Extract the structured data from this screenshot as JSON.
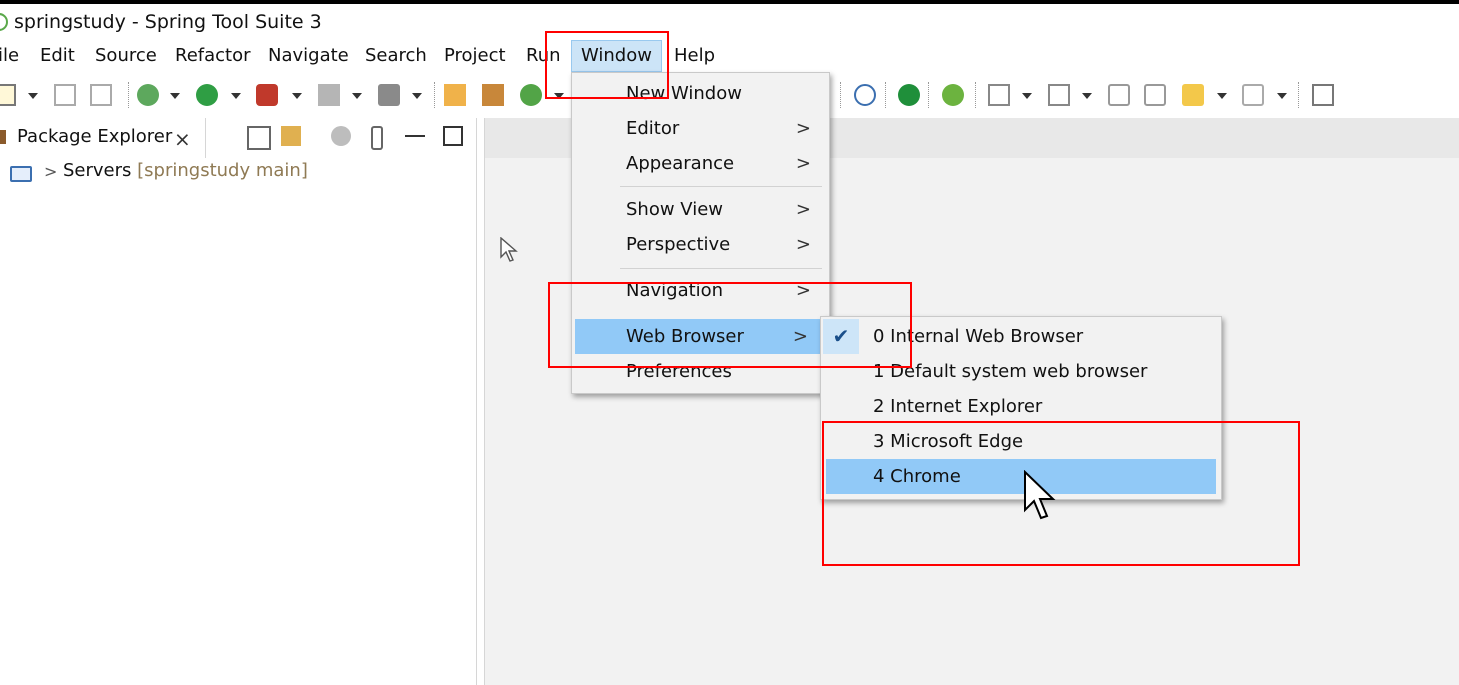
{
  "window": {
    "title": "springstudy - Spring Tool Suite 3"
  },
  "menubar": {
    "items": [
      "ile",
      "Edit",
      "Source",
      "Refactor",
      "Navigate",
      "Search",
      "Project",
      "Run",
      "Window",
      "Help"
    ]
  },
  "package_explorer": {
    "tab_label": "Package Explorer",
    "close_glyph": "⨯",
    "tree": {
      "arrow": ">",
      "name": "Servers",
      "decoration": "[springstudy main]"
    }
  },
  "window_menu": {
    "items": [
      "New Window",
      "Editor",
      "Appearance",
      "Show View",
      "Perspective",
      "Navigation",
      "Web Browser",
      "Preferences"
    ],
    "submenu_arrow": ">"
  },
  "web_browser_submenu": {
    "items": [
      "0 Internal Web Browser",
      "1 Default system web browser",
      "2 Internet Explorer",
      "3 Microsoft Edge",
      "4 Chrome"
    ],
    "checked_index": 0,
    "highlighted_index": 4,
    "check_glyph": "✔"
  },
  "colors": {
    "highlight": "#91c9f7",
    "annotation": "#ff0000",
    "menu_active": "#cce4f7"
  }
}
